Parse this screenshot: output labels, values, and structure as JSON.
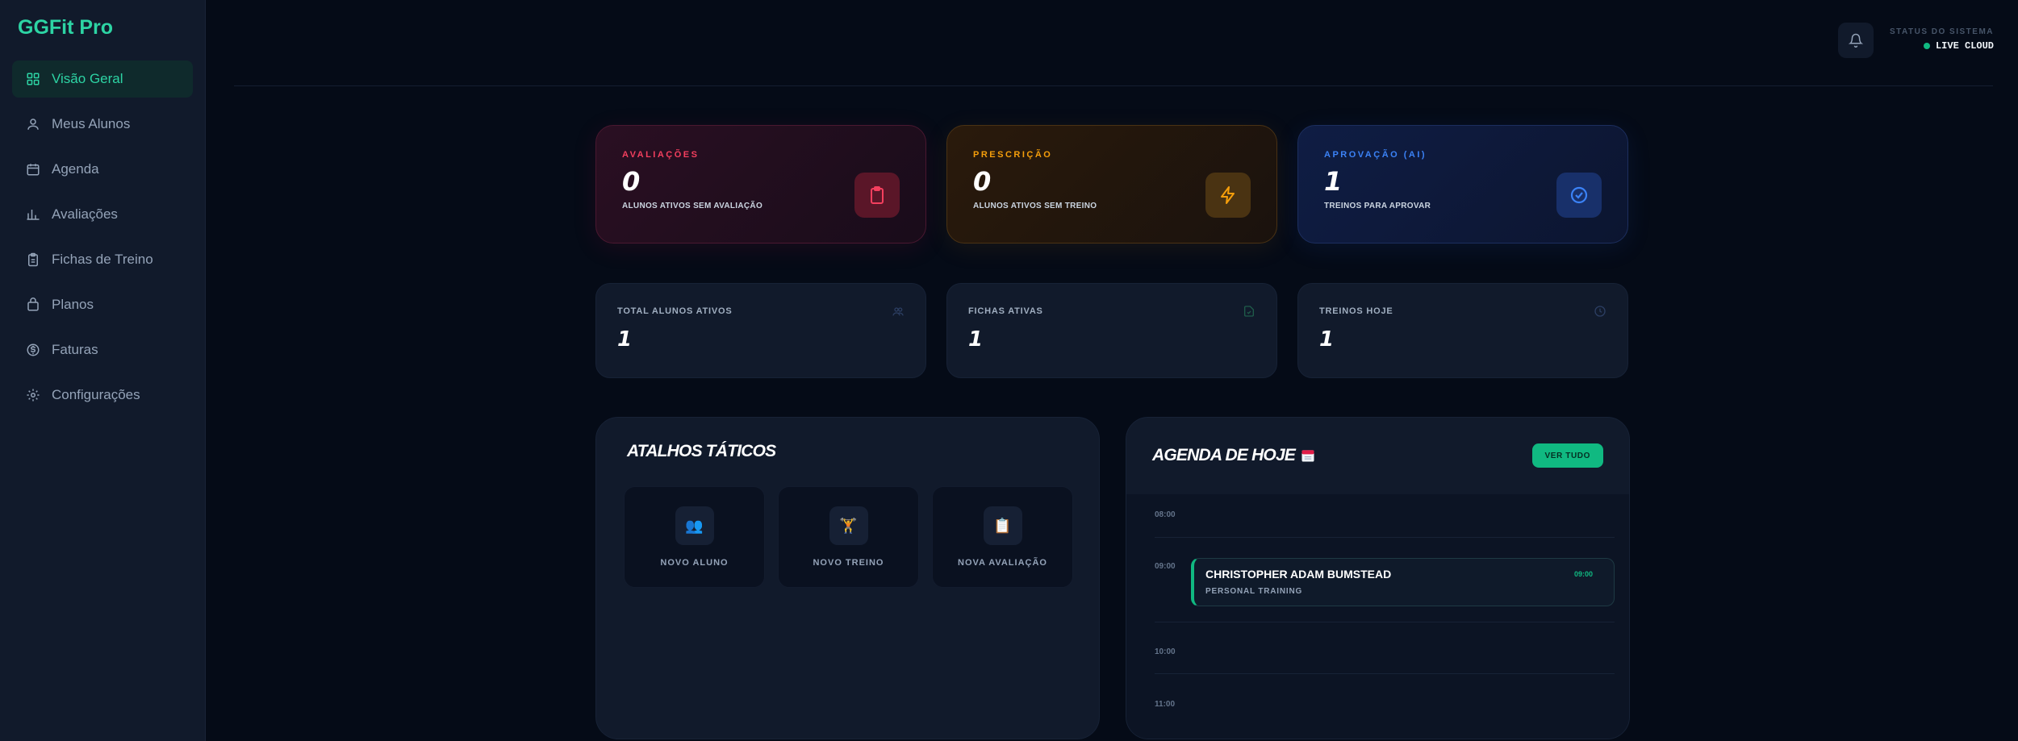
{
  "sidebar": {
    "brand": "GGFit Pro",
    "items": [
      {
        "label": "Visão Geral",
        "icon": "grid-icon"
      },
      {
        "label": "Meus Alunos",
        "icon": "users-icon"
      },
      {
        "label": "Agenda",
        "icon": "calendar-icon"
      },
      {
        "label": "Avaliações",
        "icon": "bar-chart-icon"
      },
      {
        "label": "Fichas de Treino",
        "icon": "clipboard-icon"
      },
      {
        "label": "Planos",
        "icon": "package-icon"
      },
      {
        "label": "Faturas",
        "icon": "dollar-icon"
      },
      {
        "label": "Configurações",
        "icon": "gear-icon"
      }
    ]
  },
  "header": {
    "status_title": "STATUS DO SISTEMA",
    "status_value": "LIVE CLOUD"
  },
  "kpis": [
    {
      "title": "AVALIAÇÕES",
      "value": "0",
      "subtitle": "ALUNOS ATIVOS SEM AVALIAÇÃO",
      "color": "#f43f5e"
    },
    {
      "title": "PRESCRIÇÃO",
      "value": "0",
      "subtitle": "ALUNOS ATIVOS SEM TREINO",
      "color": "#f59e0b"
    },
    {
      "title": "APROVAÇÃO (AI)",
      "value": "1",
      "subtitle": "TREINOS PARA APROVAR",
      "color": "#3b82f6"
    }
  ],
  "stats": [
    {
      "title": "TOTAL ALUNOS ATIVOS",
      "value": "1"
    },
    {
      "title": "FICHAS ATIVAS",
      "value": "1"
    },
    {
      "title": "TREINOS HOJE",
      "value": "1"
    }
  ],
  "shortcuts": {
    "title": "ATALHOS TÁTICOS",
    "items": [
      {
        "label": "NOVO ALUNO",
        "icon": "👥"
      },
      {
        "label": "NOVO TREINO",
        "icon": "🏋"
      },
      {
        "label": "NOVA AVALIAÇÃO",
        "icon": "📋"
      }
    ]
  },
  "agenda": {
    "title": "AGENDA DE HOJE",
    "view_all": "VER TUDO",
    "times": [
      "08:00",
      "09:00",
      "10:00",
      "11:00"
    ],
    "event": {
      "name": "CHRISTOPHER ADAM BUMSTEAD",
      "type": "PERSONAL TRAINING",
      "time": "09:00"
    }
  },
  "colors": {
    "accent": "#2dd4a4",
    "success": "#10b981"
  }
}
